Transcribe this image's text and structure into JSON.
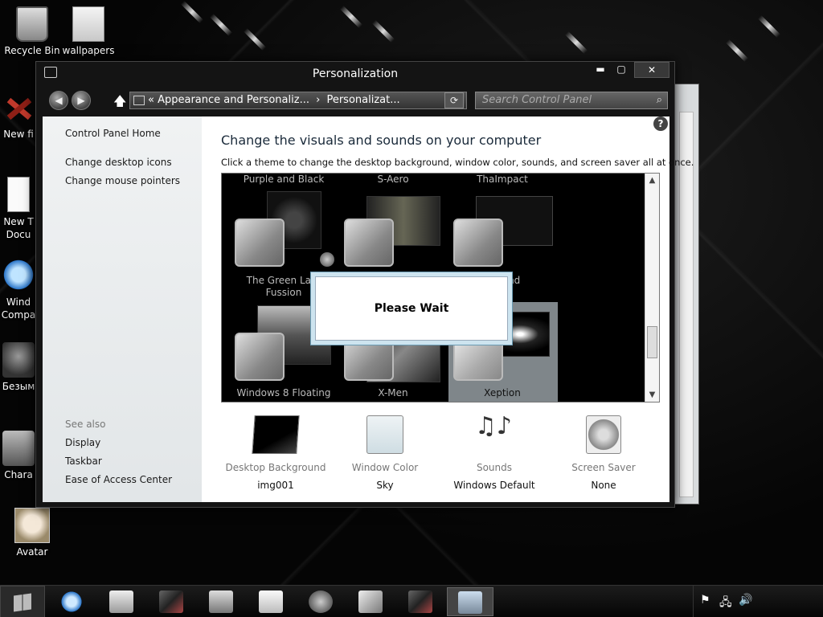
{
  "desktop": {
    "icons": [
      {
        "label": "Recycle Bin"
      },
      {
        "label": "wallpapers"
      },
      {
        "label": "New fi"
      },
      {
        "label": "New T\nDocu"
      },
      {
        "label": "Wind\nCompa"
      },
      {
        "label": "Безым"
      },
      {
        "label": "Chara"
      },
      {
        "label": "Avatar"
      }
    ]
  },
  "window": {
    "title": "Personalization",
    "controls": {
      "minimize": "▬",
      "maximize": "▢",
      "close": "✕"
    },
    "address": {
      "crumb1": "« Appearance and Personaliz...",
      "separator": "›",
      "crumb2": "Personalizat..."
    },
    "search_placeholder": "Search Control Panel",
    "sidebar": {
      "home": "Control Panel Home",
      "links": [
        "Change desktop icons",
        "Change mouse pointers"
      ],
      "see_also": "See also",
      "see_also_links": [
        "Display",
        "Taskbar",
        "Ease of Access Center"
      ]
    },
    "main": {
      "heading": "Change the visuals and sounds on your computer",
      "subheading": "Click a theme to change the desktop background, window color, sounds, and screen saver all at once.",
      "themes": [
        {
          "name": "Purple and Black"
        },
        {
          "name": "S-Aero"
        },
        {
          "name": "ThaImpact"
        },
        {
          "name": "The Green Lant\nFussion"
        },
        {
          "name": "end"
        },
        {
          "name": "Windows 8 Floating"
        },
        {
          "name": "X-Men"
        },
        {
          "name": "Xeption"
        }
      ],
      "selected_theme": "Xeption"
    },
    "dialog": {
      "message": "Please Wait"
    },
    "bottom": [
      {
        "label": "Desktop Background",
        "value": "img001"
      },
      {
        "label": "Window Color",
        "value": "Sky"
      },
      {
        "label": "Sounds",
        "value": "Windows Default"
      },
      {
        "label": "Screen Saver",
        "value": "None"
      }
    ]
  },
  "taskbar": {
    "items": [
      "internet-explorer-icon",
      "file-explorer-icon",
      "app-icon",
      "media-player-icon",
      "document-icon",
      "browser-icon",
      "tool-icon",
      "app-icon-2",
      "control-panel-icon"
    ],
    "active_item": "control-panel-icon"
  }
}
